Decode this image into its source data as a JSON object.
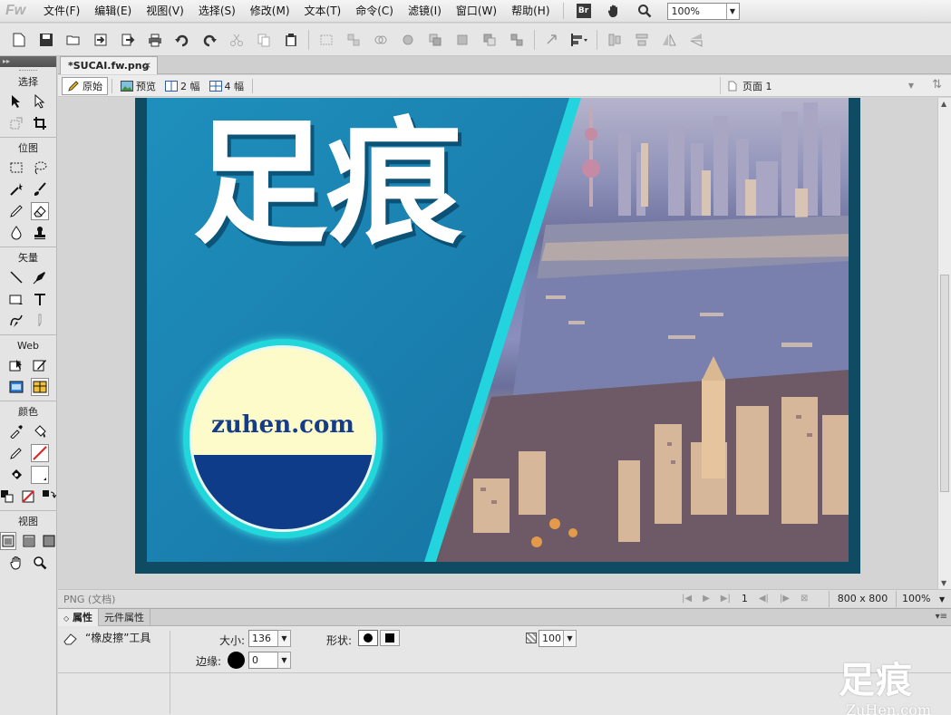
{
  "app": {
    "logo": "Fw"
  },
  "menubar": {
    "items": [
      "文件(F)",
      "编辑(E)",
      "视图(V)",
      "选择(S)",
      "修改(M)",
      "文本(T)",
      "命令(C)",
      "滤镜(I)",
      "窗口(W)",
      "帮助(H)"
    ],
    "br_label": "Br",
    "zoom_value": "100%"
  },
  "tools": {
    "collapse_glyph": "▸▸",
    "sections": {
      "select": "选择",
      "bitmap": "位图",
      "vector": "矢量",
      "web": "Web",
      "color": "颜色",
      "view": "视图"
    }
  },
  "document": {
    "tab_title": "*SUCAI.fw.png",
    "close_glyph": "×"
  },
  "viewbar": {
    "original": "原始",
    "preview": "预览",
    "two_up": "2 幅",
    "four_up": "4 幅",
    "page": "页面 1"
  },
  "artwork": {
    "title": "足痕",
    "badge_text": "zuhen.com",
    "colors": {
      "panel": "#1a7fae",
      "accent": "#23d4de",
      "badge_top": "#fdfbca",
      "badge_bottom": "#0e3c88"
    }
  },
  "statusbar": {
    "doc_type": "PNG (文档)",
    "frame": "1",
    "size": "800 x 800",
    "zoom": "100%"
  },
  "properties": {
    "tab_properties": "属性",
    "tab_symbol": "元件属性",
    "tool_name": "“橡皮擦”工具",
    "size_label": "大小:",
    "size_value": "136",
    "edge_label": "边缘:",
    "edge_value": "0",
    "shape_label": "形状:",
    "opacity_value": "100"
  },
  "watermark": {
    "cn": "足痕",
    "en": "ZuHen.com"
  }
}
